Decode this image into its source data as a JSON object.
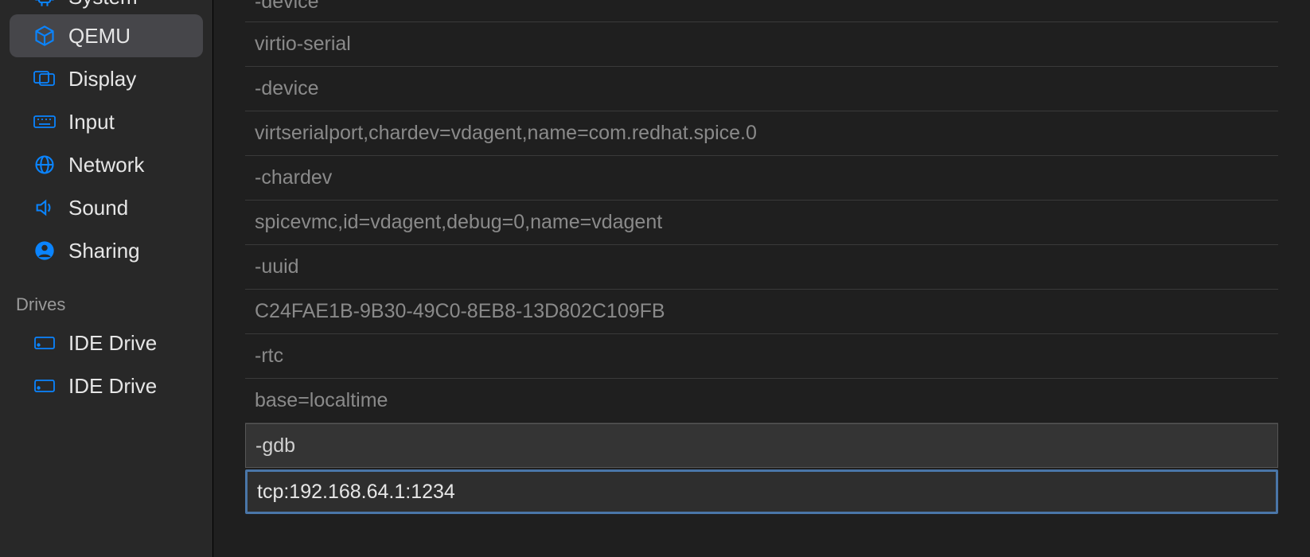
{
  "sidebar": {
    "items": [
      {
        "label": "System",
        "icon": "chip-icon"
      },
      {
        "label": "QEMU",
        "icon": "cube-icon",
        "selected": true
      },
      {
        "label": "Display",
        "icon": "display-icon"
      },
      {
        "label": "Input",
        "icon": "keyboard-icon"
      },
      {
        "label": "Network",
        "icon": "globe-icon"
      },
      {
        "label": "Sound",
        "icon": "speaker-icon"
      },
      {
        "label": "Sharing",
        "icon": "person-icon"
      }
    ],
    "sections": [
      {
        "header": "Drives",
        "items": [
          {
            "label": "IDE Drive",
            "icon": "drive-icon"
          },
          {
            "label": "IDE Drive",
            "icon": "drive-icon"
          }
        ]
      }
    ]
  },
  "arguments": [
    "-device",
    "virtio-serial",
    "-device",
    "virtserialport,chardev=vdagent,name=com.redhat.spice.0",
    "-chardev",
    "spicevmc,id=vdagent,debug=0,name=vdagent",
    "-uuid",
    "C24FAE1B-9B30-49C0-8EB8-13D802C109FB",
    "-rtc",
    "base=localtime",
    "-gdb",
    "tcp:192.168.64.1:1234"
  ]
}
